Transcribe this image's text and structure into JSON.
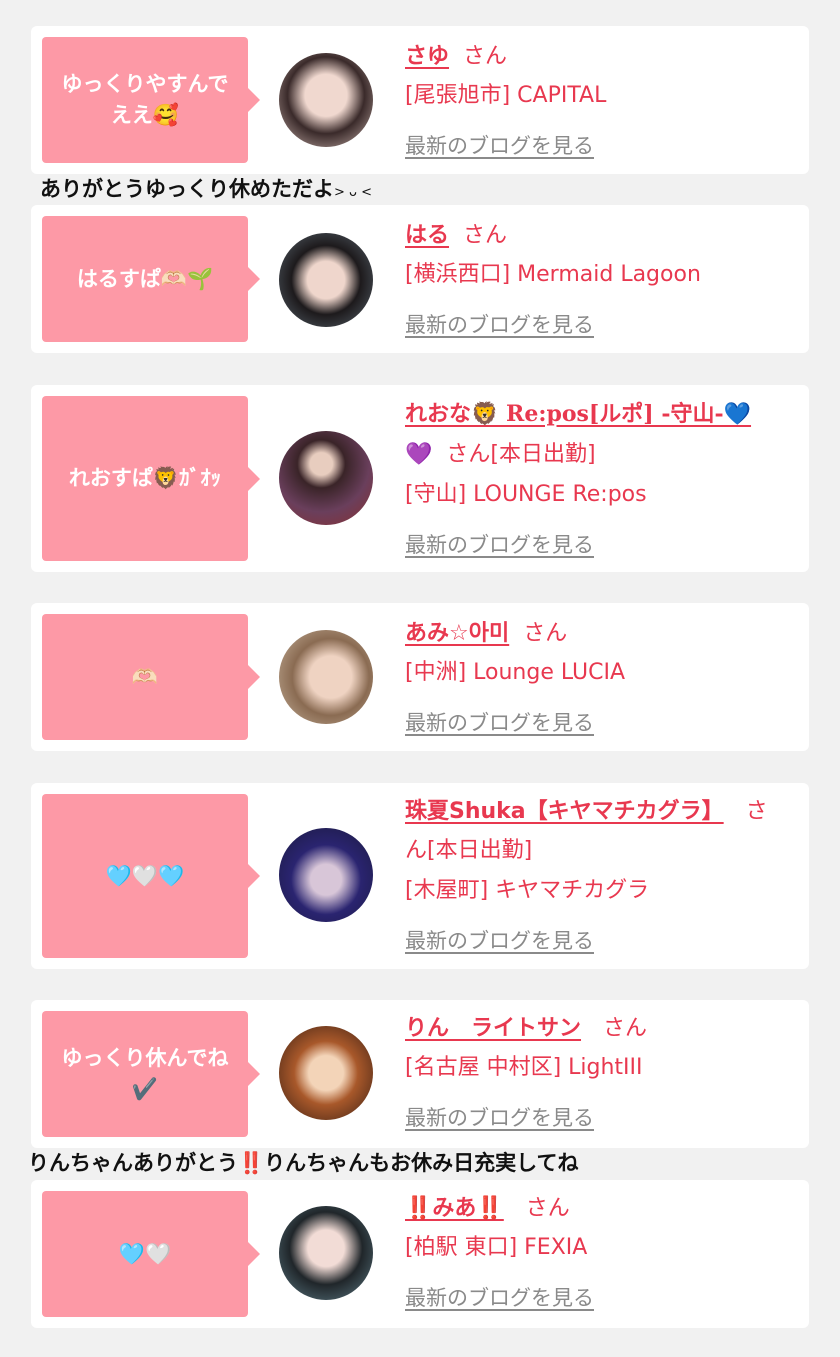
{
  "blog_link_label": "最新のブログを見る",
  "entries": [
    {
      "bubble": "ゆっくりやすんで\nええ🥰",
      "name": "さゆ",
      "san": "さん",
      "shop": "[尾張旭市] CAPITAL"
    },
    {
      "bubble": "はるすぱ🫶🏻🌱",
      "name": "はる",
      "san": "さん",
      "shop": "[横浜西口] Mermaid Lagoon"
    },
    {
      "bubble": "れおすぱ🦁ｶﾞｵｯ",
      "name": "れおな🦁 Re:pos[ルポ] -守山-💙",
      "name2": "💜",
      "san": "さん[本日出勤]",
      "shop": "[守山] LOUNGE Re:pos"
    },
    {
      "bubble": "🫶🏻",
      "name": "あみ☆아미",
      "san": "さん",
      "shop": "[中洲] Lounge LUCIA"
    },
    {
      "bubble": "🩵🤍🩵",
      "name": "珠夏Shuka【キヤマチカグラ】",
      "san": "さ",
      "san2": "ん[本日出勤]",
      "shop": "[木屋町] キヤマチカグラ"
    },
    {
      "bubble": "ゆっくり休んでね\n✔️",
      "name": "りん　ライトサン",
      "san": "さん",
      "shop": "[名古屋 中村区] LightIII"
    },
    {
      "bubble": "🩵🤍",
      "name": "‼️みあ‼️",
      "san": "さん",
      "shop": "[柏駅 東口] FEXIA"
    }
  ],
  "comments": {
    "c1": "ありがとうゆっくり休めただよ",
    "c1_face": "> ᴗ <",
    "c2_a": "りんちゃんありがとう",
    "c2_mark": "‼️",
    "c2_b": "りんちゃんもお休み日充実してね"
  },
  "colors": {
    "bubble": "#fd99a6",
    "accent": "#e8384f",
    "link_gray": "#8a8a8a",
    "background": "#f1f1f1"
  }
}
